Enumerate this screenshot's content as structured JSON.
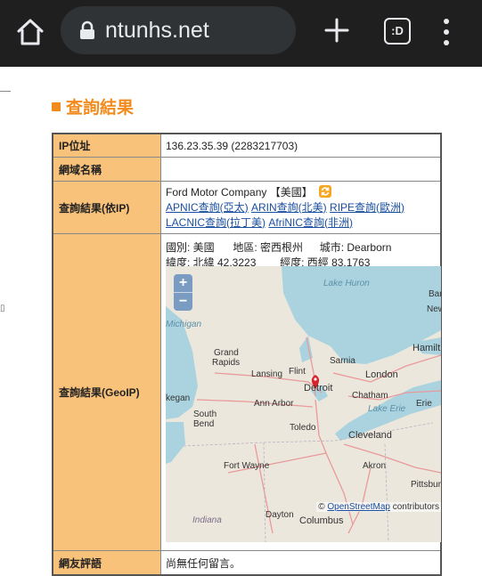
{
  "browser": {
    "url": "ntunhs.net",
    "tabs_label": ":D"
  },
  "section": {
    "title": "查詢結果"
  },
  "table": {
    "ip_label": "IP位址",
    "ip_value": "136.23.35.39 (2283217703)",
    "domain_label": "網域名稱",
    "domain_value": "",
    "result_ip_label": "查詢結果(依IP)",
    "org": "Ford Motor Company",
    "country_tag": "【美國】",
    "links": {
      "apnic": "APNIC查詢(亞太)",
      "arin": "ARIN查詢(北美)",
      "ripe": "RIPE查詢(歐洲)",
      "lacnic": "LACNIC查詢(拉丁美)",
      "afrinic": "AfriNIC查詢(非洲)"
    },
    "geo_label": "查詢結果(GeoIP)",
    "geo": {
      "country": "國別: 美國",
      "region": "地區: 密西根州",
      "city": "城市: Dearborn",
      "lat": "緯度: 北緯 42.3223",
      "lon": "經度: 西經 83.1763"
    },
    "comments_label": "網友評語",
    "comments_value": "尚無任何留言。"
  },
  "map": {
    "zoom_in": "+",
    "zoom_out": "−",
    "attribution_prefix": "© ",
    "attribution_link": "OpenStreetMap",
    "attribution_suffix": " contributors",
    "labels": {
      "lake_huron": "Lake Huron",
      "michigan": "Michigan",
      "grand_rapids_1": "Grand",
      "grand_rapids_2": "Rapids",
      "lansing": "Lansing",
      "flint": "Flint",
      "sarnia": "Sarnia",
      "bar": "Bar",
      "new": "New",
      "hamilton": "Hamilt",
      "detroit": "Detroit",
      "london": "London",
      "chatham": "Chatham",
      "lake_erie": "Lake Erie",
      "erie": "Erie",
      "ann_arbor": "Ann Arbor",
      "chicago": "kegan",
      "south_bend_1": "South",
      "south_bend_2": "Bend",
      "toledo": "Toledo",
      "cleveland": "Cleveland",
      "fort_wayne": "Fort Wayne",
      "akron": "Akron",
      "pittsburgh": "Pittsburg",
      "dayton": "Dayton",
      "columbus": "Columbus",
      "indiana": "Indiana"
    },
    "colors": {
      "water": "#aad3df",
      "land": "#ece7dc",
      "roads": "#e89a9a",
      "marker": "#d8232a"
    }
  }
}
